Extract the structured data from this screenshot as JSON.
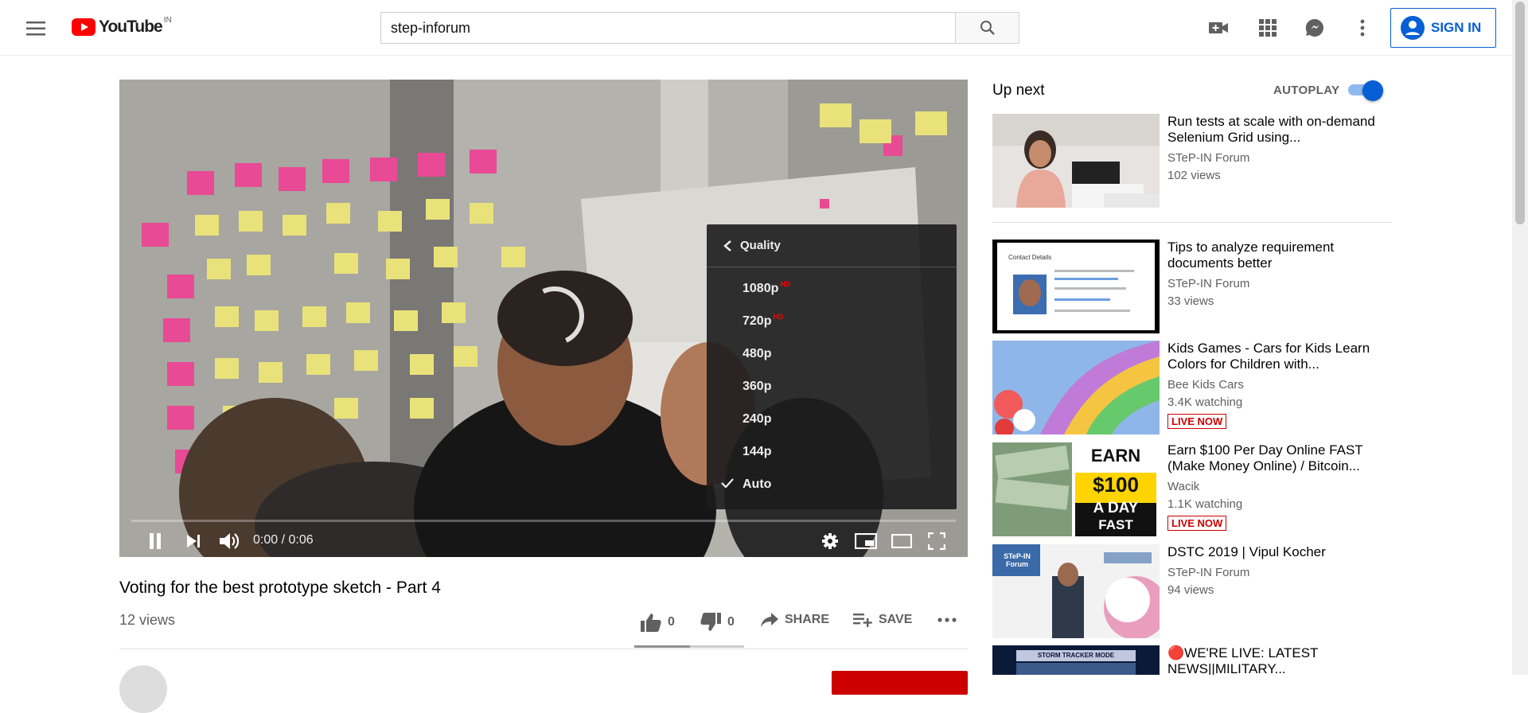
{
  "masthead": {
    "logo_text": "YouTube",
    "country_code": "IN",
    "search_value": "step-inforum",
    "search_placeholder": "Search",
    "signin_label": "SIGN IN"
  },
  "player": {
    "time_display": "0:00 / 0:06",
    "progress": 0.0,
    "quality_menu": {
      "header": "Quality",
      "options": [
        {
          "label": "1080p",
          "badge": "HD"
        },
        {
          "label": "720p",
          "badge": "HD"
        },
        {
          "label": "480p",
          "badge": ""
        },
        {
          "label": "360p",
          "badge": ""
        },
        {
          "label": "240p",
          "badge": ""
        },
        {
          "label": "144p",
          "badge": ""
        },
        {
          "label": "Auto",
          "badge": "",
          "selected": true
        }
      ]
    }
  },
  "video": {
    "title": "Voting for the best prototype sketch - Part 4",
    "views": "12 views",
    "likes": "0",
    "dislikes": "0",
    "share_label": "SHARE",
    "save_label": "SAVE"
  },
  "sidebar": {
    "upnext_label": "Up next",
    "autoplay_label": "AUTOPLAY",
    "autoplay_on": true,
    "items": [
      {
        "title": "Run tests at scale with on-demand Selenium Grid using...",
        "channel": "STeP-IN Forum",
        "meta": "102 views",
        "live": ""
      },
      {
        "title": "Tips to analyze requirement documents better",
        "channel": "STeP-IN Forum",
        "meta": "33 views",
        "live": "",
        "thumb_text": "Contact Details"
      },
      {
        "title": "Kids Games - Cars for Kids Learn Colors for Children with...",
        "channel": "Bee Kids Cars",
        "meta": "3.4K watching",
        "live": "LIVE NOW"
      },
      {
        "title": "Earn $100 Per Day Online FAST (Make Money Online) / Bitcoin...",
        "channel": "Wacik",
        "meta": "1.1K watching",
        "live": "LIVE NOW",
        "thumb_text": [
          "EARN",
          "$100",
          "A DAY",
          "FAST"
        ]
      },
      {
        "title": "DSTC 2019 | Vipul Kocher",
        "channel": "STeP-IN Forum",
        "meta": "94 views",
        "live": "",
        "thumb_text": "STeP-IN Forum"
      },
      {
        "title": "🔴WE'RE LIVE: LATEST NEWS||MILITARY...",
        "channel": "",
        "meta": "",
        "live": "",
        "thumb_text": "STORM TRACKER MODE"
      }
    ]
  },
  "colors": {
    "brand_red": "#ff0000",
    "link_blue": "#065fd4",
    "live_red": "#cc0000"
  }
}
